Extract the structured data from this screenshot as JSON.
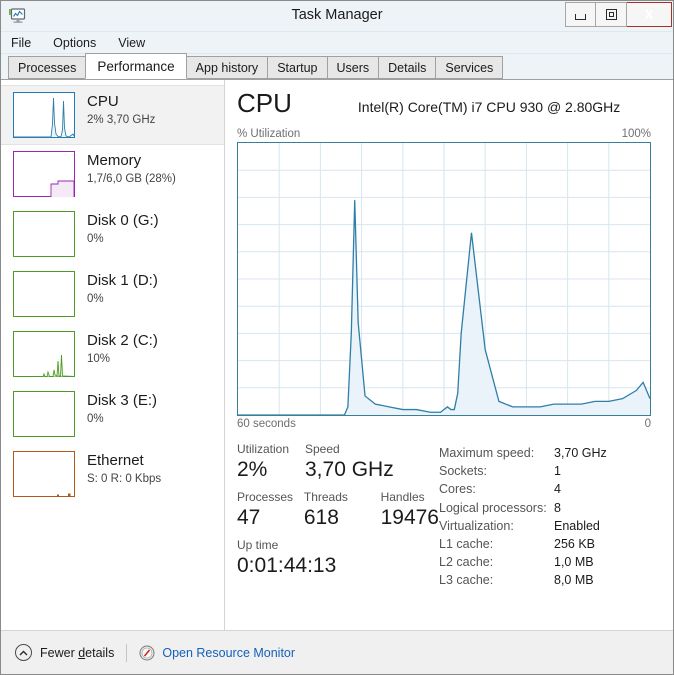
{
  "window": {
    "title": "Task Manager",
    "icon": "taskmanager-monitor-icon",
    "controls": {
      "minimize": "minimize-icon",
      "maximize": "restore-icon",
      "close": "X"
    }
  },
  "menu": {
    "items": [
      "File",
      "Options",
      "View"
    ]
  },
  "tabs": [
    {
      "label": "Processes",
      "active": false
    },
    {
      "label": "Performance",
      "active": true
    },
    {
      "label": "App history",
      "active": false
    },
    {
      "label": "Startup",
      "active": false
    },
    {
      "label": "Users",
      "active": false
    },
    {
      "label": "Details",
      "active": false
    },
    {
      "label": "Services",
      "active": false
    }
  ],
  "sidebar": {
    "items": [
      {
        "name": "cpu",
        "title": "CPU",
        "sub": "2%  3,70 GHz",
        "color": "#1f7bb8",
        "selected": true
      },
      {
        "name": "memory",
        "title": "Memory",
        "sub": "1,7/6,0 GB (28%)",
        "color": "#9b27b0",
        "selected": false
      },
      {
        "name": "disk0",
        "title": "Disk 0 (G:)",
        "sub": "0%",
        "color": "#4e9a28",
        "selected": false
      },
      {
        "name": "disk1",
        "title": "Disk 1 (D:)",
        "sub": "0%",
        "color": "#4e9a28",
        "selected": false
      },
      {
        "name": "disk2",
        "title": "Disk 2 (C:)",
        "sub": "10%",
        "color": "#4e9a28",
        "selected": false
      },
      {
        "name": "disk3",
        "title": "Disk 3 (E:)",
        "sub": "0%",
        "color": "#4e9a28",
        "selected": false
      },
      {
        "name": "ethernet",
        "title": "Ethernet",
        "sub": "S: 0 R: 0 Kbps",
        "color": "#b5561a",
        "selected": false
      }
    ]
  },
  "main": {
    "title": "CPU",
    "model": "Intel(R) Core(TM) i7 CPU 930 @ 2.80GHz",
    "graph": {
      "y_label": "% Utilization",
      "y_max_label": "100%",
      "x_left_label": "60 seconds",
      "x_right_label": "0",
      "line_color": "#2f7ea8",
      "fill_color": "#eaf3fa",
      "border_color": "#3b7e97",
      "grid_color": "#d8e6ef"
    },
    "stats": [
      {
        "label": "Utilization",
        "value": "2%"
      },
      {
        "label": "Speed",
        "value": "3,70 GHz"
      },
      {
        "label": "Processes",
        "value": "47"
      },
      {
        "label": "Threads",
        "value": "618"
      },
      {
        "label": "Handles",
        "value": "19476"
      },
      {
        "label": "Up time",
        "value": "0:01:44:13"
      }
    ],
    "specs": [
      {
        "label": "Maximum speed:",
        "value": "3,70 GHz"
      },
      {
        "label": "Sockets:",
        "value": "1"
      },
      {
        "label": "Cores:",
        "value": "4"
      },
      {
        "label": "Logical processors:",
        "value": "8"
      },
      {
        "label": "Virtualization:",
        "value": "Enabled"
      },
      {
        "label": "L1 cache:",
        "value": "256 KB"
      },
      {
        "label": "L2 cache:",
        "value": "1,0 MB"
      },
      {
        "label": "L3 cache:",
        "value": "8,0 MB"
      }
    ]
  },
  "statusbar": {
    "fewer_details_prefix": "Fewer ",
    "fewer_details_underline": "d",
    "fewer_details_suffix": "etails",
    "resource_monitor": "Open Resource Monitor",
    "link_color": "#1560bd"
  },
  "chart_data": {
    "type": "area",
    "title": "CPU % Utilization",
    "xlabel": "60 seconds",
    "ylabel": "% Utilization",
    "ylim": [
      0,
      100
    ],
    "xlim": [
      60,
      0
    ],
    "grid": true,
    "grid_divisions_x": 10,
    "grid_divisions_y": 10,
    "legend": "none",
    "series": [
      {
        "name": "CPU Utilization",
        "x": [
          60,
          48,
          44.5,
          44.0,
          43.5,
          43.0,
          42.5,
          41.5,
          40.0,
          38.0,
          36.0,
          34.0,
          32.0,
          30.5,
          29.5,
          29.0,
          28.5,
          28.0,
          27.5,
          26.0,
          24.0,
          22.0,
          20.0,
          18.0,
          16.0,
          14.0,
          12.0,
          10.0,
          8.0,
          6.0,
          4.0,
          2.0,
          1.0,
          0.0
        ],
        "values": [
          0,
          0,
          0,
          3,
          30,
          79,
          34,
          7,
          4,
          3,
          2,
          2,
          1,
          1,
          3,
          2,
          2,
          8,
          30,
          67,
          24,
          5,
          3,
          3,
          3,
          4,
          4,
          4,
          5,
          5,
          6,
          9,
          12,
          6
        ]
      }
    ]
  }
}
